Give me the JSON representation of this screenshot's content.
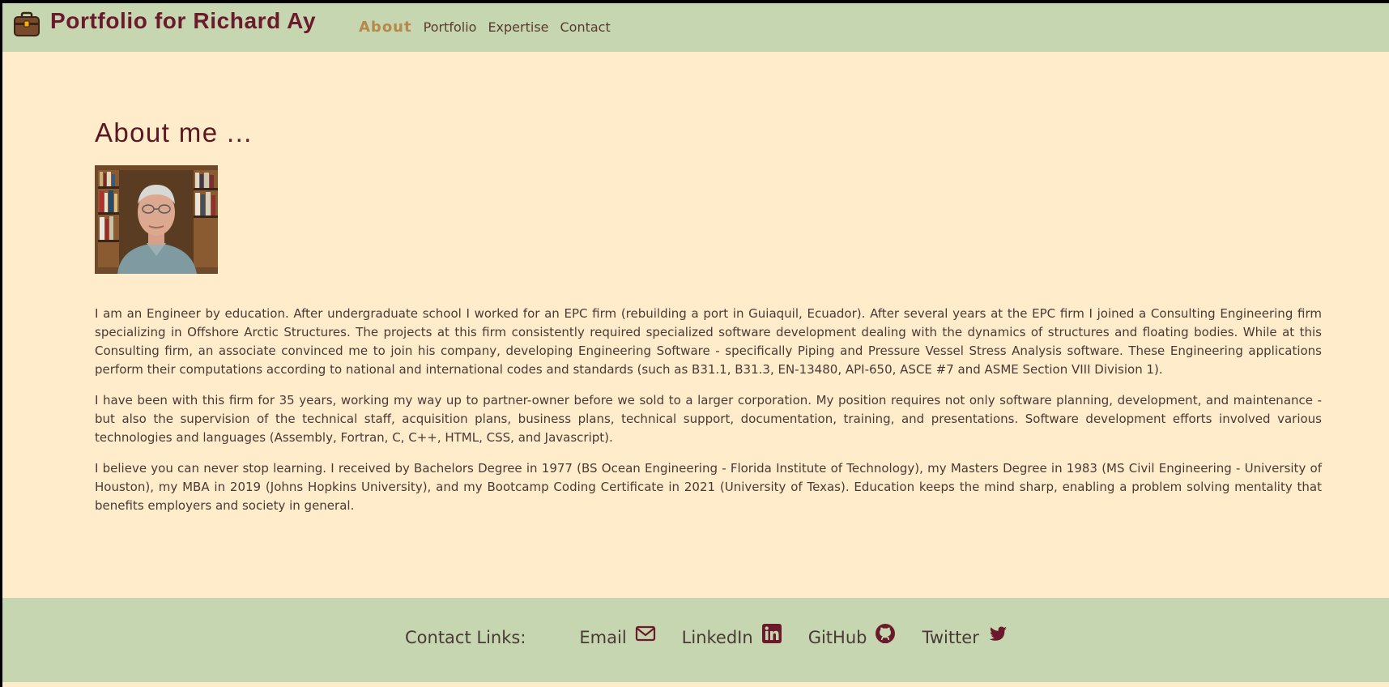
{
  "header": {
    "title": "Portfolio for Richard Ay",
    "logo_icon": "briefcase-icon",
    "nav": [
      {
        "label": "About",
        "active": true
      },
      {
        "label": "Portfolio",
        "active": false
      },
      {
        "label": "Expertise",
        "active": false
      },
      {
        "label": "Contact",
        "active": false
      }
    ]
  },
  "main": {
    "heading": "About me ...",
    "paragraphs": [
      "I am an Engineer by education. After undergraduate school I worked for an EPC firm (rebuilding a port in Guiaquil, Ecuador). After several years at the EPC firm I joined a Consulting Engineering firm specializing in Offshore Arctic Structures. The projects at this firm consistently required specialized software development dealing with the dynamics of structures and floating bodies. While at this Consulting firm, an associate convinced me to join his company, developing Engineering Software - specifically Piping and Pressure Vessel Stress Analysis software. These Engineering applications perform their computations according to national and international codes and standards (such as B31.1, B31.3, EN-13480, API-650, ASCE #7 and ASME Section VIII Division 1).",
      "I have been with this firm for 35 years, working my way up to partner-owner before we sold to a larger corporation. My position requires not only software planning, development, and maintenance - but also the supervision of the technical staff, acquisition plans, business plans, technical support, documentation, training, and presentations. Software development efforts involved various technologies and languages (Assembly, Fortran, C, C++, HTML, CSS, and Javascript).",
      "I believe you can never stop learning. I received by Bachelors Degree in 1977 (BS Ocean Engineering - Florida Institute of Technology), my Masters Degree in 1983 (MS Civil Engineering - University of Houston), my MBA in 2019 (Johns Hopkins University), and my Bootcamp Coding Certificate in 2021 (University of Texas). Education keeps the mind sharp, enabling a problem solving mentality that benefits employers and society in general."
    ]
  },
  "footer": {
    "label": "Contact Links:",
    "links": [
      {
        "label": "Email",
        "icon": "envelope-icon"
      },
      {
        "label": "LinkedIn",
        "icon": "linkedin-icon"
      },
      {
        "label": "GitHub",
        "icon": "github-icon"
      },
      {
        "label": "Twitter",
        "icon": "twitter-icon"
      }
    ]
  },
  "colors": {
    "header_bg": "#c5d6b0",
    "page_bg": "#feeccb",
    "title": "#6b1a2c",
    "nav_active": "#b8874a",
    "text": "#4a3a35"
  }
}
